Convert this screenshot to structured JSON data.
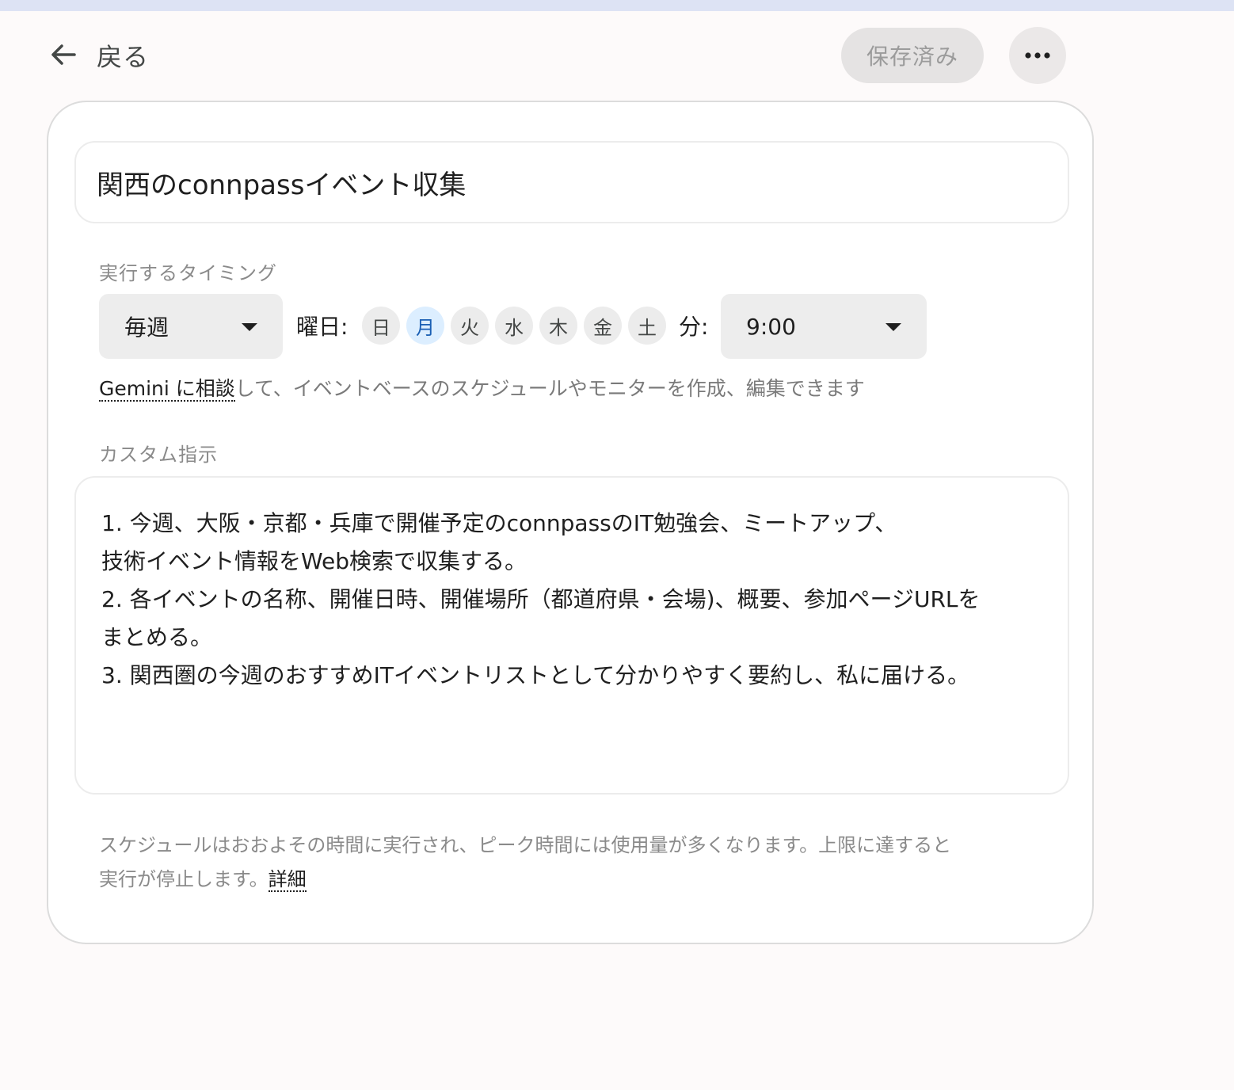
{
  "header": {
    "back_label": "戻る",
    "saved_label": "保存済み"
  },
  "form": {
    "title_value": "関西のconnpassイベント収集",
    "timing": {
      "section_label": "実行するタイミング",
      "frequency": "毎週",
      "days_label": "曜日:",
      "days": [
        {
          "label": "日",
          "selected": false
        },
        {
          "label": "月",
          "selected": true
        },
        {
          "label": "火",
          "selected": false
        },
        {
          "label": "水",
          "selected": false
        },
        {
          "label": "木",
          "selected": false
        },
        {
          "label": "金",
          "selected": false
        },
        {
          "label": "土",
          "selected": false
        }
      ],
      "minute_label": "分:",
      "time": "9:00"
    },
    "hint": {
      "link_text": "Gemini に相談",
      "rest_text": "して、イベントベースのスケジュールやモニターを作成、編集できます"
    },
    "custom": {
      "section_label": "カスタム指示",
      "lines": [
        "1. 今週、大阪・京都・兵庫で開催予定のconnpassのIT勉強会、ミートアップ、",
        "技術イベント情報をWeb検索で収集する。",
        "2. 各イベントの名称、開催日時、開催場所（都道府県・会場)、概要、参加ページURLを",
        "まとめる。",
        "3. 関西圏の今週のおすすめITイベントリストとして分かりやすく要約し、私に届ける。"
      ]
    },
    "footnote": {
      "line1": "スケジュールはおおよその時間に実行され、ピーク時間には使用量が多くなります。上限に達すると",
      "line2": "実行が停止します。",
      "link": "詳細"
    }
  },
  "colors": {
    "selected_day_bg": "#dceeff",
    "selected_day_text": "#1a5fb4",
    "top_strip": "#dde3f4"
  },
  "icons": {
    "back": "arrow-left-icon",
    "more": "more-horiz-icon",
    "dropdown": "caret-down-icon"
  }
}
